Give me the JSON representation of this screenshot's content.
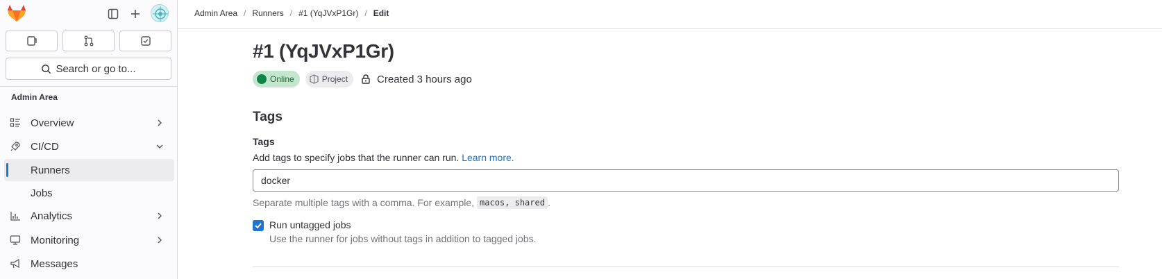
{
  "sidebar": {
    "quick_actions": [
      {
        "icon": "issues-icon"
      },
      {
        "icon": "merge-request-icon"
      },
      {
        "icon": "todo-icon"
      }
    ],
    "search_label": "Search or go to...",
    "section_title": "Admin Area",
    "items": [
      {
        "label": "Overview",
        "icon": "overview-icon",
        "expanded": false
      },
      {
        "label": "CI/CD",
        "icon": "rocket-icon",
        "expanded": true
      },
      {
        "label": "Runners",
        "active": true
      },
      {
        "label": "Jobs"
      },
      {
        "label": "Analytics",
        "icon": "chart-icon",
        "expanded": false
      },
      {
        "label": "Monitoring",
        "icon": "monitor-icon",
        "expanded": false
      },
      {
        "label": "Messages",
        "icon": "bullhorn-icon"
      }
    ]
  },
  "breadcrumbs": [
    "Admin Area",
    "Runners",
    "#1 (YqJVxP1Gr)",
    "Edit"
  ],
  "runner": {
    "title": "#1 (YqJVxP1Gr)",
    "status": "Online",
    "type": "Project",
    "created": "Created 3 hours ago"
  },
  "tags_section": {
    "title": "Tags",
    "label": "Tags",
    "description": "Add tags to specify jobs that the runner can run.",
    "learn_more": "Learn more.",
    "value": "docker",
    "help_prefix": "Separate multiple tags with a comma. For example,",
    "help_example": "macos, shared",
    "help_suffix": ".",
    "untagged_label": "Run untagged jobs",
    "untagged_help": "Use the runner for jobs without tags in addition to tagged jobs.",
    "untagged_checked": true
  },
  "colors": {
    "accent": "#1f75cb",
    "online_bg": "#c3e6cd",
    "online_dot": "#108548"
  }
}
